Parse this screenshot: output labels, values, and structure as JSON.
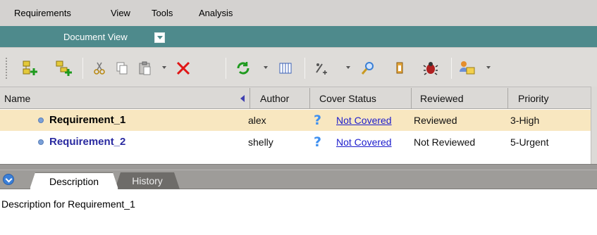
{
  "menubar": {
    "items": [
      "Requirements",
      "View",
      "Tools",
      "Analysis"
    ]
  },
  "view_selector": {
    "label": "Document View"
  },
  "toolbar": {
    "icons": [
      "new-requirement-icon",
      "new-child-requirement-icon",
      "cut-icon",
      "copy-icon",
      "paste-icon",
      "delete-icon",
      "refresh-icon",
      "columns-icon",
      "add-link-icon",
      "find-icon",
      "attachment-icon",
      "defect-icon",
      "users-icon"
    ]
  },
  "table": {
    "columns": [
      "Name",
      "Author",
      "Cover Status",
      "Reviewed",
      "Priority"
    ],
    "rows": [
      {
        "name": "Requirement_1",
        "author": "alex",
        "cover_status": "Not Covered",
        "reviewed": "Reviewed",
        "priority": "3-High"
      },
      {
        "name": "Requirement_2",
        "author": "shelly",
        "cover_status": "Not Covered",
        "reviewed": "Not Reviewed",
        "priority": "5-Urgent"
      }
    ]
  },
  "tabs": [
    "Description",
    "History"
  ],
  "description": {
    "text": "Description for Requirement_1"
  },
  "colors": {
    "accent": "#4e8a8c",
    "selected_row": "#f8e7c0",
    "link": "#1d1dcc"
  }
}
